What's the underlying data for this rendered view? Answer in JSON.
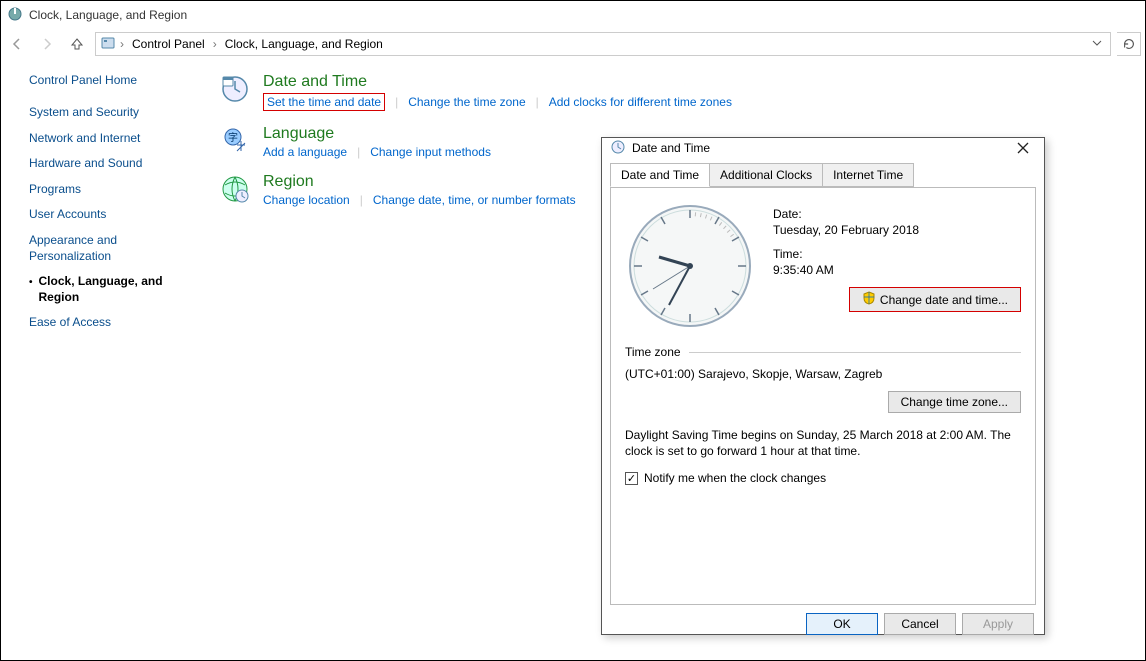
{
  "window": {
    "title": "Clock, Language, and Region"
  },
  "breadcrumb": {
    "root": "Control Panel",
    "current": "Clock, Language, and Region"
  },
  "sidebar": {
    "header": "Control Panel Home",
    "items": [
      {
        "label": "System and Security"
      },
      {
        "label": "Network and Internet"
      },
      {
        "label": "Hardware and Sound"
      },
      {
        "label": "Programs"
      },
      {
        "label": "User Accounts"
      },
      {
        "label": "Appearance and Personalization"
      },
      {
        "label": "Clock, Language, and Region"
      },
      {
        "label": "Ease of Access"
      }
    ]
  },
  "categories": {
    "datetime": {
      "title": "Date and Time",
      "links": [
        "Set the time and date",
        "Change the time zone",
        "Add clocks for different time zones"
      ]
    },
    "language": {
      "title": "Language",
      "links": [
        "Add a language",
        "Change input methods"
      ]
    },
    "region": {
      "title": "Region",
      "links": [
        "Change location",
        "Change date, time, or number formats"
      ]
    }
  },
  "dialog": {
    "title": "Date and Time",
    "tabs": [
      "Date and Time",
      "Additional Clocks",
      "Internet Time"
    ],
    "date_label": "Date:",
    "date_value": "Tuesday, 20 February 2018",
    "time_label": "Time:",
    "time_value": "9:35:40 AM",
    "change_dt_btn": "Change date and time...",
    "tz_header": "Time zone",
    "tz_value": "(UTC+01:00) Sarajevo, Skopje, Warsaw, Zagreb",
    "change_tz_btn": "Change time zone...",
    "dst_text": "Daylight Saving Time begins on Sunday, 25 March 2018 at 2:00 AM. The clock is set to go forward 1 hour at that time.",
    "notify_label": "Notify me when the clock changes",
    "notify_checked": true,
    "buttons": {
      "ok": "OK",
      "cancel": "Cancel",
      "apply": "Apply"
    }
  }
}
